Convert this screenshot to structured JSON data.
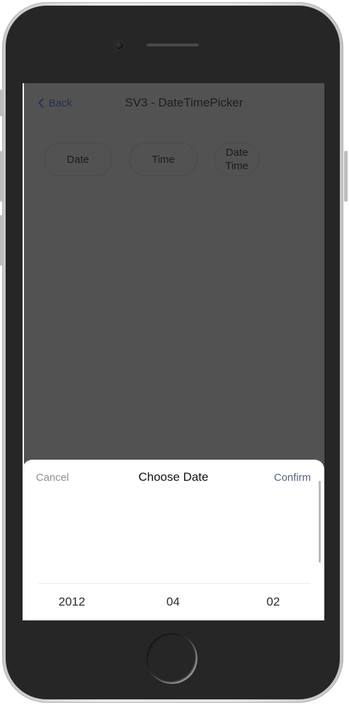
{
  "nav": {
    "back_label": "Back",
    "title": "SV3 - DateTimePicker"
  },
  "buttons": {
    "date": "Date",
    "time": "Time",
    "datetime_line1": "Date",
    "datetime_line2": "Time"
  },
  "picker": {
    "cancel_label": "Cancel",
    "title": "Choose Date",
    "confirm_label": "Confirm",
    "year": "2012",
    "month": "04",
    "day": "02"
  },
  "colors": {
    "overlay": "#525252",
    "back_link": "#1f3150",
    "confirm": "#55647f",
    "cancel": "#8f8f8f"
  }
}
